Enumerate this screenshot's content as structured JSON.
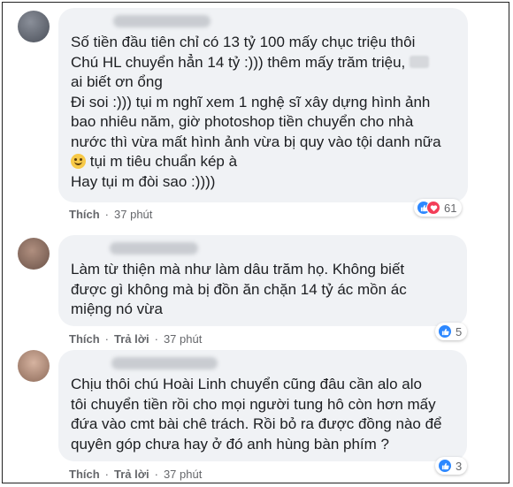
{
  "comments": [
    {
      "lines_before_emoji": "Số tiền đầu tiên chỉ có 13 tỷ 100 mấy chục triệu thôi\nChú HL chuyển hẳn 14 tỷ :))) thêm mấy trăm triệu,",
      "line_after_redact": "ai biết ơn ổng\nĐi soi :))) tụi m nghĩ xem 1 nghệ sĩ xây dựng hình ảnh\nbao nhiêu năm, giờ photoshop tiền chuyển cho nhà\nnước thì vừa mất hình ảnh vừa bị quy vào tội danh nữa",
      "emoji_line": "tụi m tiêu chuẩn kép à",
      "last_line": "Hay tụi m đòi sao :))))",
      "like_label": "Thích",
      "time": "37 phút",
      "reaction_count": "61"
    },
    {
      "text": "Làm từ thiện mà như làm dâu trăm họ. Không biết\nđược gì không mà bị đồn ăn chặn 14 tỷ ác mồn ác\nmiệng nó vừa",
      "like_label": "Thích",
      "reply_label": "Trả lời",
      "time": "37 phút",
      "reaction_count": "5"
    },
    {
      "text": "Chịu thôi chú Hoài Linh chuyển cũng đâu cần alo alo\ntôi chuyển tiền rồi cho mọi người tung hô còn hơn mấy\nđứa vào cmt bài chê trách. Rồi bỏ ra được đồng nào để\nquyên góp chưa hay ở đó anh hùng bàn phím ?",
      "like_label": "Thích",
      "reply_label": "Trả lời",
      "time": "37 phút",
      "reaction_count": "3"
    }
  ],
  "colors": {
    "bubble": "#f0f2f5",
    "like_blue": "#2d88ff",
    "love_red": "#f33e58",
    "meta_text": "#65676b"
  }
}
